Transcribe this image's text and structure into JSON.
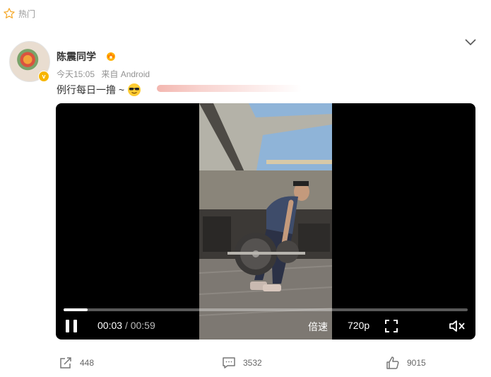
{
  "hot_label": "热门",
  "user": {
    "name": "陈震同学"
  },
  "meta": {
    "time": "今天15:05",
    "source": "来自 Android"
  },
  "post": {
    "text": "例行每日一撸 ~"
  },
  "video": {
    "current": "00:03",
    "separator": "/",
    "duration": "00:59",
    "progress_fraction": 0.06,
    "speed_label": "倍速",
    "quality_label": "720p"
  },
  "actions": {
    "reposts": "448",
    "comments": "3532",
    "likes": "9015"
  },
  "icons": [
    "star-outline-icon",
    "chevron-down-icon",
    "verified-badge-icon",
    "crown-badge-icon",
    "sunglasses-emoji-icon",
    "pause-icon",
    "fullscreen-icon",
    "mute-icon",
    "repost-icon",
    "comment-icon",
    "like-icon"
  ],
  "colors": {
    "accent": "#f7b500",
    "muted_text": "#939393",
    "video_bg": "#000000"
  }
}
